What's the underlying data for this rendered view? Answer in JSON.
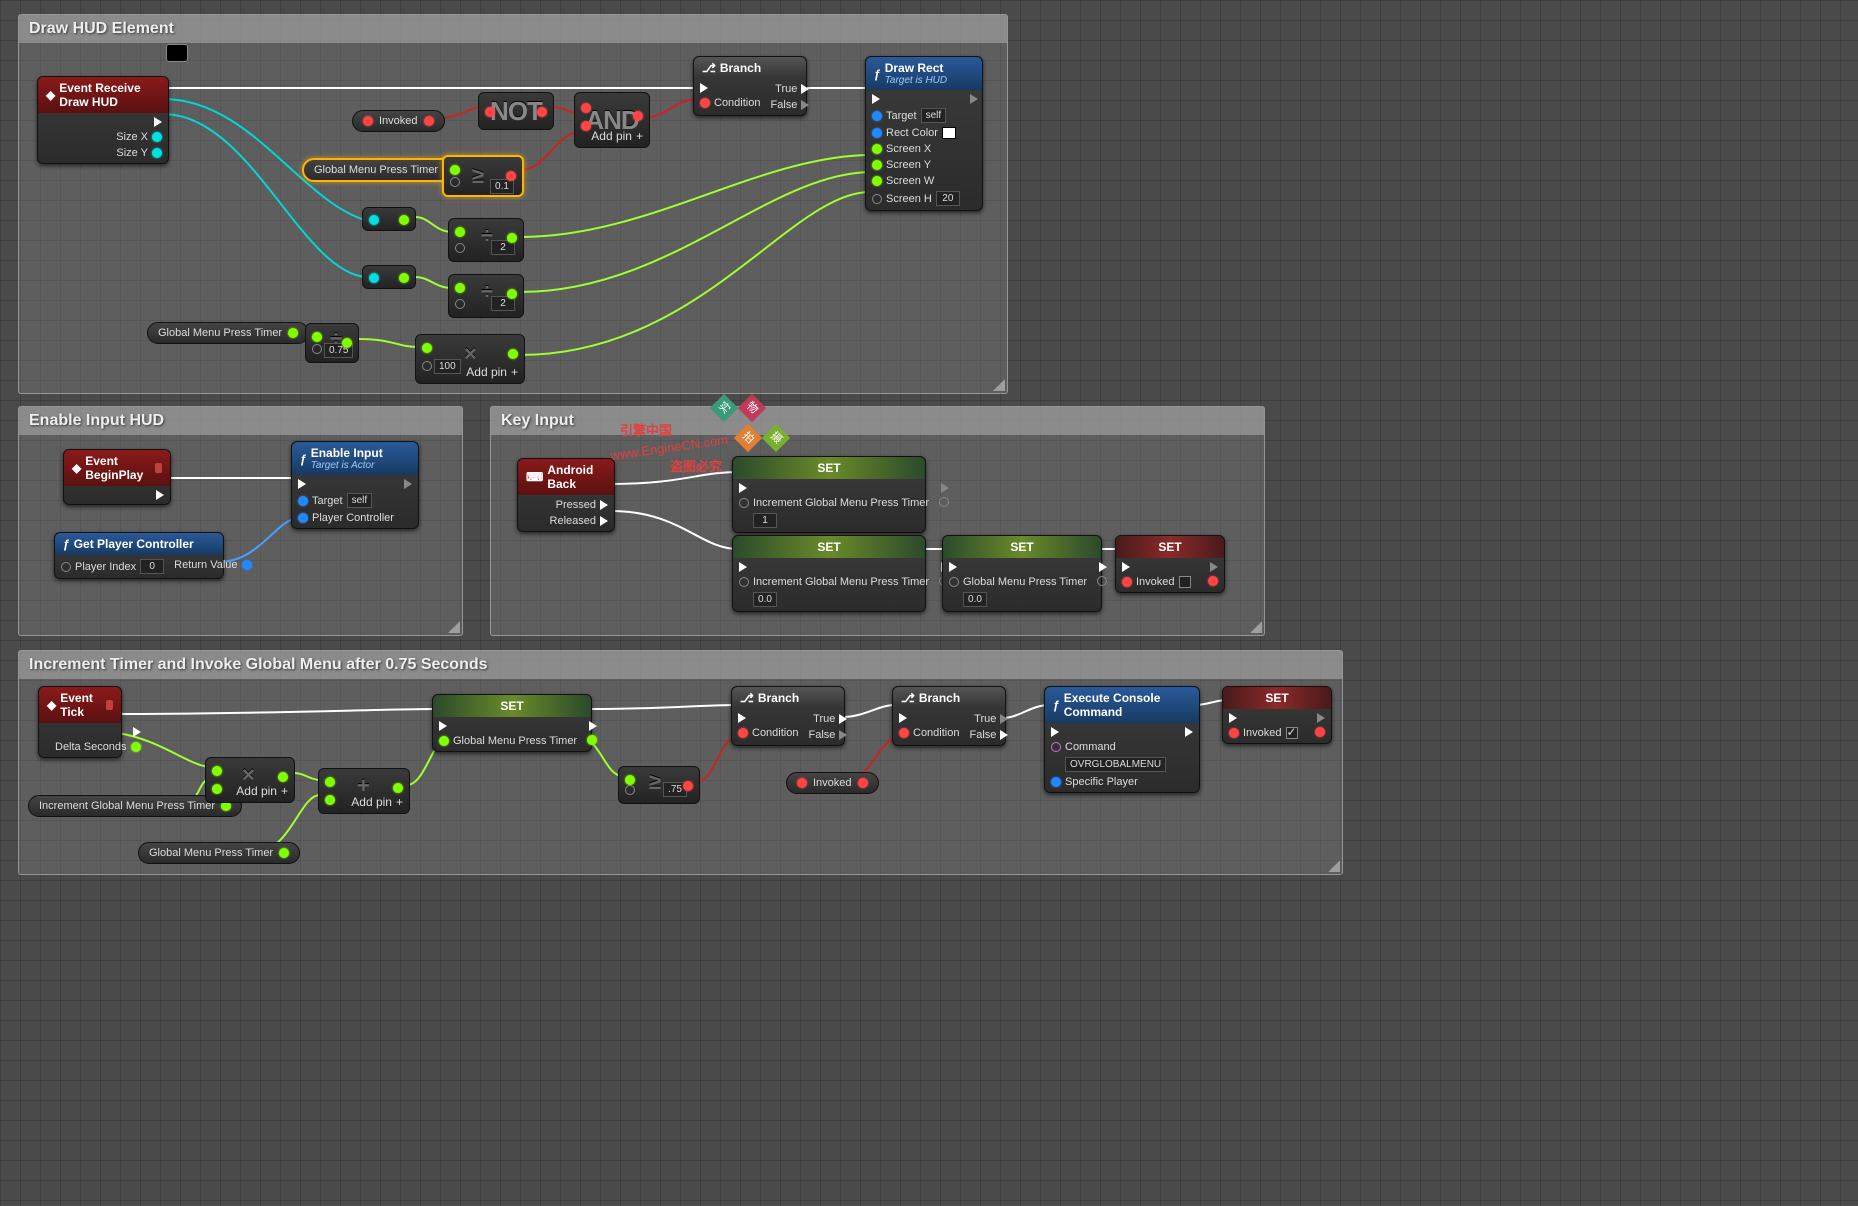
{
  "comments": {
    "hud": "Draw HUD Element",
    "enable": "Enable Input HUD",
    "key": "Key Input",
    "timer": "Increment Timer and Invoke Global Menu after 0.75 Seconds"
  },
  "hudPanel": {
    "event": {
      "title": "Event Receive Draw HUD",
      "sizex": "Size X",
      "sizey": "Size Y"
    },
    "invoked": "Invoked",
    "globalMenu": "Global Menu Press Timer",
    "ge01": "0.1",
    "div2a": "2",
    "div2b": "2",
    "div075": "0.75",
    "mul100": "100",
    "addpin": "Add pin",
    "not": "NOT",
    "and": "AND",
    "branch": {
      "title": "Branch",
      "cond": "Condition",
      "t": "True",
      "f": "False"
    },
    "drawrect": {
      "title": "Draw Rect",
      "sub": "Target is HUD",
      "target": "Target",
      "self": "self",
      "rectcolor": "Rect Color",
      "sx": "Screen X",
      "sy": "Screen Y",
      "sw": "Screen W",
      "sh": "Screen H",
      "shv": "20"
    }
  },
  "enablePanel": {
    "begin": "Event BeginPlay",
    "enable": {
      "title": "Enable Input",
      "sub": "Target is Actor",
      "target": "Target",
      "self": "self",
      "pc": "Player Controller"
    },
    "getpc": {
      "title": "Get Player Controller",
      "idx": "Player Index",
      "idxv": "0",
      "rv": "Return Value"
    }
  },
  "keyPanel": {
    "ab": {
      "title": "Android Back",
      "pressed": "Pressed",
      "released": "Released"
    },
    "set": "SET",
    "incLabel": "Increment Global Menu Press Timer",
    "gmLabel": "Global Menu Press Timer",
    "inc1": "1",
    "zero": "0.0",
    "invoked": "Invoked"
  },
  "timerPanel": {
    "tick": {
      "title": "Event Tick",
      "delta": "Delta Seconds"
    },
    "incPill": "Increment Global Menu Press Timer",
    "gmPill": "Global Menu Press Timer",
    "addpin": "Add pin",
    "set": "SET",
    "gmSet": "Global Menu Press Timer",
    "ge075": ".75",
    "branch": {
      "title": "Branch",
      "cond": "Condition",
      "t": "True",
      "f": "False"
    },
    "invoked": "Invoked",
    "exec": {
      "title": "Execute Console Command",
      "cmd": "Command",
      "cmdv": "OVRGLOBALMENU",
      "sp": "Specific Player"
    },
    "setInv": {
      "title": "SET",
      "invoked": "Invoked"
    }
  },
  "watermark": {
    "text1": "引擎中国",
    "url": "www.EngineCN.com",
    "text2": "盗图必究",
    "b1": "实",
    "b2": "物",
    "b3": "拍",
    "b4": "摄"
  }
}
